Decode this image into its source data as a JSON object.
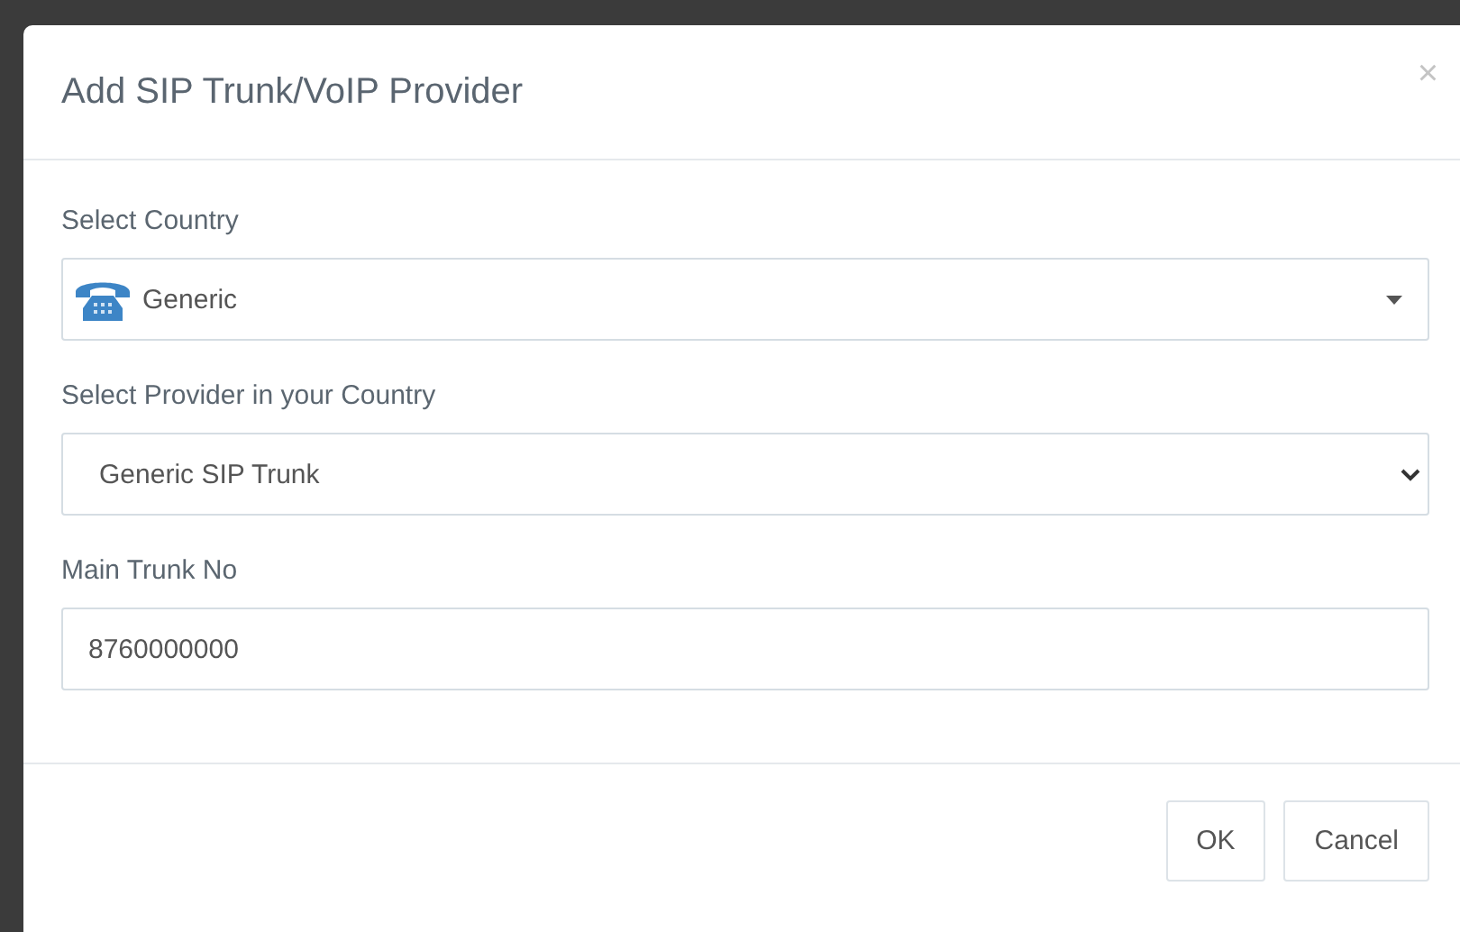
{
  "dialog": {
    "title": "Add SIP Trunk/VoIP Provider",
    "close": "×"
  },
  "fields": [
    {
      "kind": "icon-select",
      "label": "Select Country",
      "value": "Generic"
    },
    {
      "kind": "select",
      "label": "Select Provider in your Country",
      "value": "Generic SIP Trunk"
    },
    {
      "kind": "text",
      "label": "Main Trunk No",
      "value": "8760000000"
    }
  ],
  "buttons": [
    "OK",
    "Cancel"
  ]
}
